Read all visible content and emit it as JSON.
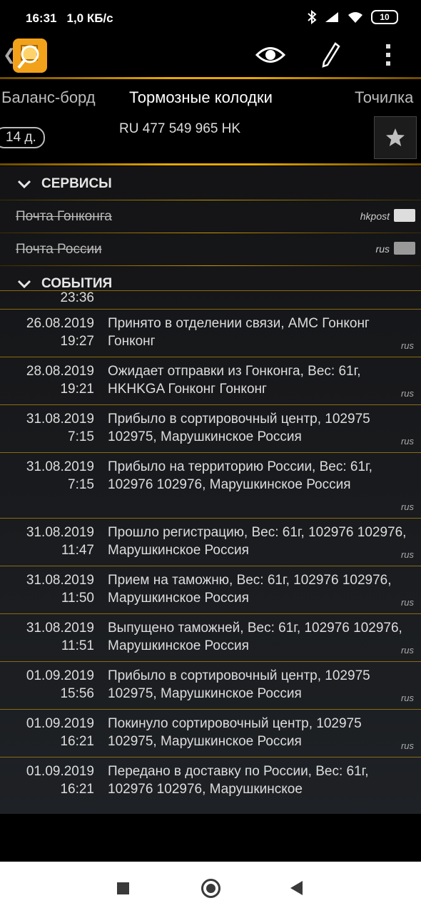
{
  "status": {
    "time": "16:31",
    "speed": "1,0 КБ/с",
    "battery": "10"
  },
  "tabs": [
    {
      "label": "Баланс-борд"
    },
    {
      "label": "Тормозные колодки"
    },
    {
      "label": "Точилка"
    }
  ],
  "parcel": {
    "days": "14 д.",
    "track": "RU 477 549 965 HK"
  },
  "services_header": "СЕРВИСЫ",
  "services": [
    {
      "name": "Почта Гонконга",
      "code": "hkpost"
    },
    {
      "name": "Почта России",
      "code": "rus"
    }
  ],
  "events_header": "СОБЫТИЯ",
  "events": [
    {
      "date": "",
      "time": "23:36",
      "desc": "",
      "src": ""
    },
    {
      "date": "26.08.2019",
      "time": "19:27",
      "desc": "Принято в отделении связи, АМС Гонконг Гонконг",
      "src": "rus"
    },
    {
      "date": "28.08.2019",
      "time": "19:21",
      "desc": "Ожидает отправки из Гонконга, Вес: 61г, HKHKGA Гонконг Гонконг",
      "src": "rus"
    },
    {
      "date": "31.08.2019",
      "time": "7:15",
      "desc": "Прибыло в сортировочный центр, 102975 102975, Марушкинское Россия",
      "src": "rus"
    },
    {
      "date": "31.08.2019",
      "time": "7:15",
      "desc": "Прибыло на территорию России, Вес: 61г, 102976 102976, Марушкинское Россия",
      "src": "rus"
    },
    {
      "date": "31.08.2019",
      "time": "11:47",
      "desc": "Прошло регистрацию, Вес: 61г, 102976 102976, Марушкинское Россия",
      "src": "rus"
    },
    {
      "date": "31.08.2019",
      "time": "11:50",
      "desc": "Прием на таможню, Вес: 61г, 102976 102976, Марушкинское Россия",
      "src": "rus"
    },
    {
      "date": "31.08.2019",
      "time": "11:51",
      "desc": "Выпущено таможней, Вес: 61г, 102976 102976, Марушкинское Россия",
      "src": "rus"
    },
    {
      "date": "01.09.2019",
      "time": "15:56",
      "desc": "Прибыло в сортировочный центр, 102975 102975, Марушкинское Россия",
      "src": "rus"
    },
    {
      "date": "01.09.2019",
      "time": "16:21",
      "desc": "Покинуло сортировочный центр, 102975 102975, Марушкинское Россия",
      "src": "rus"
    },
    {
      "date": "01.09.2019",
      "time": "16:21",
      "desc": "Передано в доставку по России, Вес: 61г, 102976 102976, Марушкинское",
      "src": ""
    }
  ]
}
